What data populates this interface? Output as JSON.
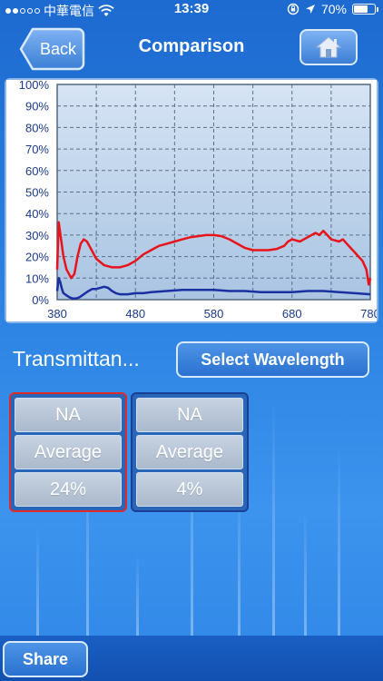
{
  "status_bar": {
    "carrier": "中華電信",
    "time": "13:39",
    "battery": "70%",
    "battery_level": 0.7
  },
  "nav": {
    "back_label": "Back",
    "title": "Comparison"
  },
  "chart_data": {
    "type": "line",
    "xlim": [
      380,
      780
    ],
    "ylim": [
      0,
      100
    ],
    "x_ticks": [
      "380",
      "480",
      "580",
      "680",
      "780"
    ],
    "y_ticks": [
      "100%",
      "90%",
      "80%",
      "70%",
      "60%",
      "50%",
      "40%",
      "30%",
      "20%",
      "10%",
      "0%"
    ],
    "grid": true,
    "series": [
      {
        "color": "#e8141c",
        "x": [
          380,
          382,
          385,
          388,
          392,
          398,
          402,
          406,
          410,
          414,
          418,
          424,
          430,
          440,
          450,
          460,
          470,
          480,
          490,
          500,
          510,
          520,
          530,
          540,
          550,
          560,
          570,
          580,
          590,
          600,
          610,
          620,
          630,
          640,
          650,
          660,
          670,
          675,
          680,
          690,
          700,
          710,
          715,
          720,
          725,
          730,
          740,
          745,
          750,
          755,
          760,
          765,
          770,
          775,
          778,
          780
        ],
        "y": [
          14,
          36,
          28,
          20,
          14,
          10,
          12,
          20,
          26,
          28,
          27,
          23,
          19,
          16,
          15,
          15,
          16,
          18,
          21,
          23,
          25,
          26,
          27,
          28,
          29,
          29.5,
          30,
          30,
          29.5,
          28,
          26,
          24,
          23,
          23,
          23,
          23.5,
          25,
          27,
          28,
          27,
          29,
          31,
          30,
          32,
          30,
          28,
          27,
          28,
          26,
          24,
          22,
          20,
          18,
          14,
          7,
          10
        ]
      },
      {
        "color": "#1a2fa0",
        "x": [
          380,
          382,
          384,
          386,
          388,
          392,
          396,
          400,
          404,
          408,
          412,
          416,
          420,
          425,
          430,
          440,
          445,
          450,
          455,
          460,
          470,
          480,
          490,
          500,
          520,
          540,
          560,
          580,
          600,
          620,
          640,
          660,
          680,
          700,
          720,
          740,
          760,
          780
        ],
        "y": [
          4,
          10,
          8,
          5,
          3,
          2,
          1,
          0.5,
          0.5,
          1,
          2,
          3,
          4,
          5,
          5,
          6,
          5.5,
          4,
          3,
          2.5,
          2.5,
          3,
          3,
          3.5,
          4,
          4.5,
          4.5,
          4.5,
          4,
          4,
          3.5,
          3.5,
          3.5,
          4,
          4,
          3.5,
          3,
          2.5
        ]
      }
    ]
  },
  "controls": {
    "metric_label": "Transmittan...",
    "select_label": "Select Wavelength"
  },
  "cards": [
    {
      "border_color": "#e02a2a",
      "name": "NA",
      "stat": "Average",
      "value": "24%"
    },
    {
      "border_color": "#1a3f96",
      "name": "NA",
      "stat": "Average",
      "value": "4%"
    }
  ],
  "footer": {
    "share_label": "Share"
  },
  "icons": {
    "home": "home-icon",
    "wifi": "wifi-icon",
    "lock": "orientation-lock-icon",
    "location": "location-arrow-icon",
    "battery": "battery-icon"
  }
}
